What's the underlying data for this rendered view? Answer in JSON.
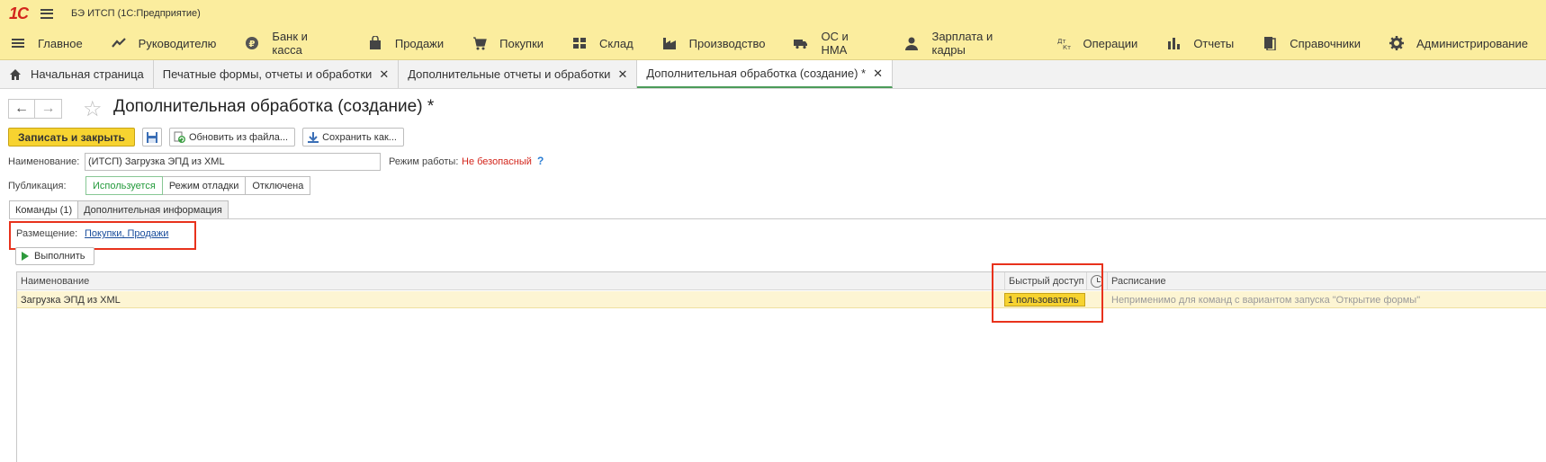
{
  "app": {
    "logo_text": "1С",
    "title": "БЭ ИТСП  (1С:Предприятие)"
  },
  "sections": [
    {
      "label": "Главное",
      "icon": "menu-icon"
    },
    {
      "label": "Руководителю",
      "icon": "trend-icon"
    },
    {
      "label": "Банк и касса",
      "icon": "ruble-coin-icon"
    },
    {
      "label": "Продажи",
      "icon": "shopping-bag-icon"
    },
    {
      "label": "Покупки",
      "icon": "cart-icon"
    },
    {
      "label": "Склад",
      "icon": "warehouse-grid-icon"
    },
    {
      "label": "Производство",
      "icon": "factory-icon"
    },
    {
      "label": "ОС и НМА",
      "icon": "truck-icon"
    },
    {
      "label": "Зарплата и кадры",
      "icon": "person-icon"
    },
    {
      "label": "Операции",
      "icon": "debit-credit-icon"
    },
    {
      "label": "Отчеты",
      "icon": "bar-chart-icon"
    },
    {
      "label": "Справочники",
      "icon": "books-icon"
    },
    {
      "label": "Администрирование",
      "icon": "gear-icon"
    }
  ],
  "tabs": [
    {
      "label": "Начальная страница",
      "closable": false,
      "active": false
    },
    {
      "label": "Печатные формы, отчеты и обработки",
      "closable": true,
      "active": false
    },
    {
      "label": "Дополнительные отчеты и обработки",
      "closable": true,
      "active": false
    },
    {
      "label": "Дополнительная обработка (создание) *",
      "closable": true,
      "active": true
    }
  ],
  "tab_close_glyph": "✕",
  "form": {
    "title": "Дополнительная обработка (создание) *",
    "toolbar": {
      "save_close_label": "Записать и закрыть",
      "update_from_file_label": "Обновить из файла...",
      "save_as_label": "Сохранить как..."
    },
    "name_label": "Наименование:",
    "name_value": "(ИТСП) Загрузка ЭПД из XML",
    "mode_label": "Режим работы:",
    "mode_value": "Не безопасный",
    "help_glyph": "?",
    "publication_label": "Публикация:",
    "publication_options": [
      "Используется",
      "Режим отладки",
      "Отключена"
    ],
    "publication_selected": "Используется",
    "page_tabs": [
      "Команды (1)",
      "Дополнительная информация"
    ],
    "placement_label": "Размещение:",
    "placement_value": "Покупки, Продажи",
    "execute_label": "Выполнить",
    "table": {
      "columns": [
        "Наименование",
        "Быстрый доступ",
        "Расписание"
      ],
      "rows": [
        {
          "name": "Загрузка ЭПД из XML",
          "quick_access": "1 пользователь",
          "schedule": "Неприменимо для команд с вариантом запуска \"Открытие формы\""
        }
      ]
    }
  },
  "colors": {
    "header_bg": "#fbed9e",
    "primary_button": "#f7d330",
    "active_tab_accent": "#4b9b59",
    "mode_warning": "#d3261c",
    "highlight_box": "#e8321c",
    "selected_row": "#fdf5d3"
  }
}
